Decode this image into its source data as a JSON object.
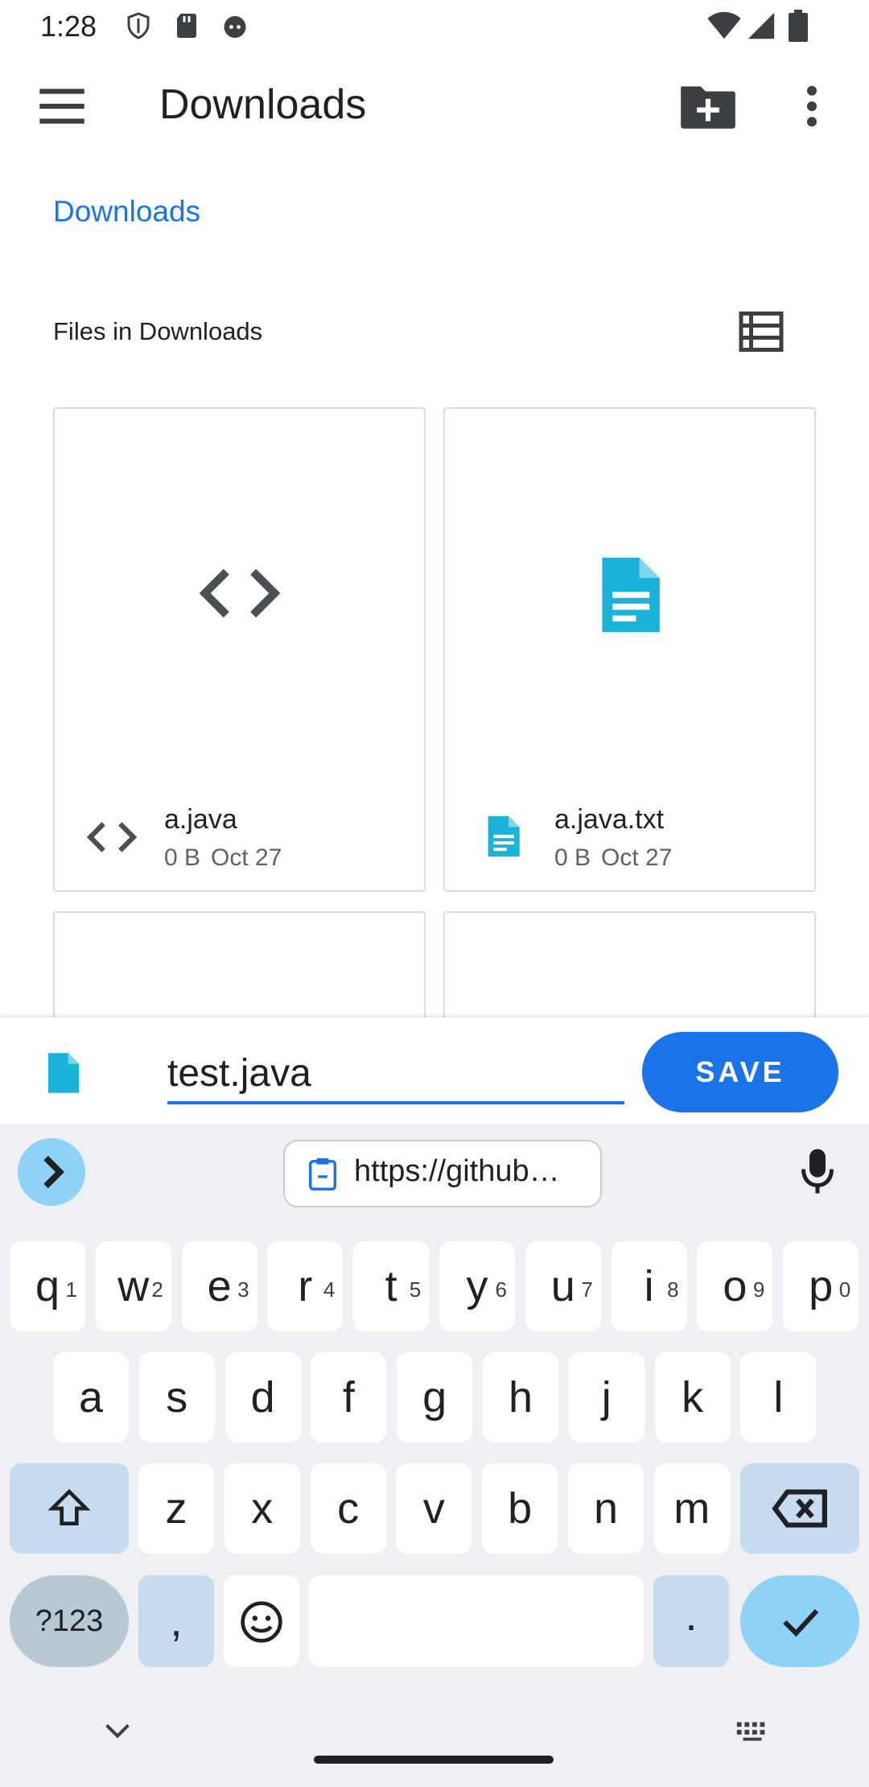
{
  "status_bar": {
    "time": "1:28"
  },
  "app_bar": {
    "title": "Downloads"
  },
  "breadcrumb": {
    "label": "Downloads"
  },
  "section": {
    "header": "Files in Downloads"
  },
  "files": [
    {
      "name": "a.java",
      "size": "0 B",
      "date": "Oct 27",
      "icon": "code-icon"
    },
    {
      "name": "a.java.txt",
      "size": "0 B",
      "date": "Oct 27",
      "icon": "document-icon"
    }
  ],
  "save_bar": {
    "filename_value": "test.java",
    "save_label": "SAVE"
  },
  "keyboard": {
    "clipboard_text": "https://github…",
    "row1": [
      {
        "k": "q",
        "h": "1"
      },
      {
        "k": "w",
        "h": "2"
      },
      {
        "k": "e",
        "h": "3"
      },
      {
        "k": "r",
        "h": "4"
      },
      {
        "k": "t",
        "h": "5"
      },
      {
        "k": "y",
        "h": "6"
      },
      {
        "k": "u",
        "h": "7"
      },
      {
        "k": "i",
        "h": "8"
      },
      {
        "k": "o",
        "h": "9"
      },
      {
        "k": "p",
        "h": "0"
      }
    ],
    "row2": [
      "a",
      "s",
      "d",
      "f",
      "g",
      "h",
      "j",
      "k",
      "l"
    ],
    "row3": [
      "z",
      "x",
      "c",
      "v",
      "b",
      "n",
      "m"
    ],
    "sym_label": "?123",
    "comma": ",",
    "period": "."
  },
  "colors": {
    "accent": "#1a73e8",
    "doc_icon": "#1ab2d8",
    "key_special": "#c8dcef",
    "enter": "#8ed2f7"
  }
}
